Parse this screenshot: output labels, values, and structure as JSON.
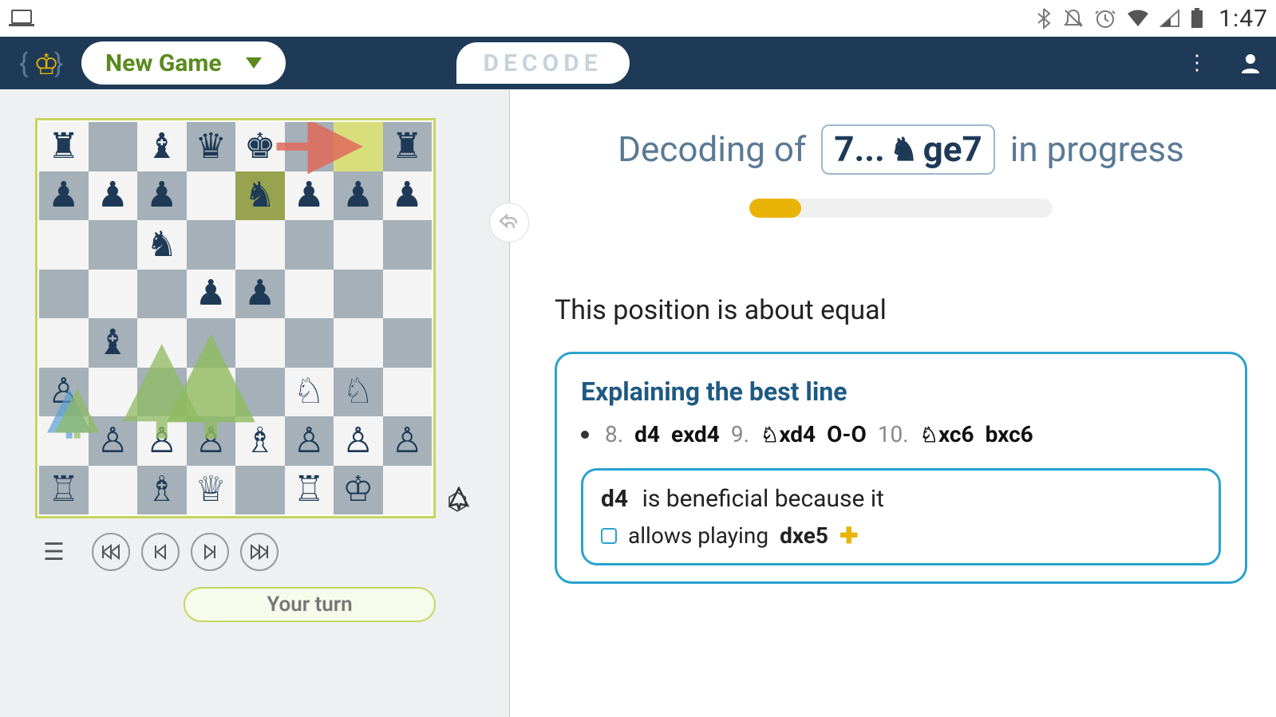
{
  "status": {
    "clock": "1:47"
  },
  "header": {
    "newGame": "New Game",
    "decode": "DECODE"
  },
  "board": {
    "pieces": [
      [
        "br",
        "",
        "bb",
        "bq",
        "bk",
        "",
        "",
        "br"
      ],
      [
        "bp",
        "bp",
        "bp",
        "",
        "bn",
        "bp",
        "bp",
        "bp"
      ],
      [
        "",
        "",
        "bn",
        "",
        "",
        "",
        "",
        ""
      ],
      [
        "",
        "",
        "",
        "bp",
        "bp",
        "",
        "",
        ""
      ],
      [
        "",
        "bb",
        "",
        "",
        "",
        "",
        "",
        ""
      ],
      [
        "wp",
        "",
        "",
        "",
        "",
        "wn",
        "wn",
        ""
      ],
      [
        "",
        "wp",
        "wp",
        "wp",
        "wb",
        "wp",
        "wp",
        "wp"
      ],
      [
        "wr",
        "",
        "wb",
        "wq",
        "",
        "wr",
        "wk",
        ""
      ]
    ],
    "highlightFrom": "e7",
    "highlightTo": "g8",
    "turnLabel": "Your turn"
  },
  "decode": {
    "title_pre": "Decoding of",
    "move_number": "7...",
    "move_san": "ge7",
    "title_post": "in progress",
    "progressPct": 17,
    "summary": "This position is about equal",
    "bestLine": {
      "title": "Explaining the best line",
      "moves": [
        {
          "n": "8.",
          "a": "d4",
          "b": "exd4"
        },
        {
          "n": "9.",
          "a": "♘xd4",
          "b": "O-O",
          "icon": true
        },
        {
          "n": "10.",
          "a": "♘xc6",
          "b": "bxc6",
          "icon": true
        }
      ],
      "explanation": {
        "move": "d4",
        "text": "is beneficial because it",
        "sub": "allows playing",
        "subMove": "dxe5"
      }
    }
  }
}
